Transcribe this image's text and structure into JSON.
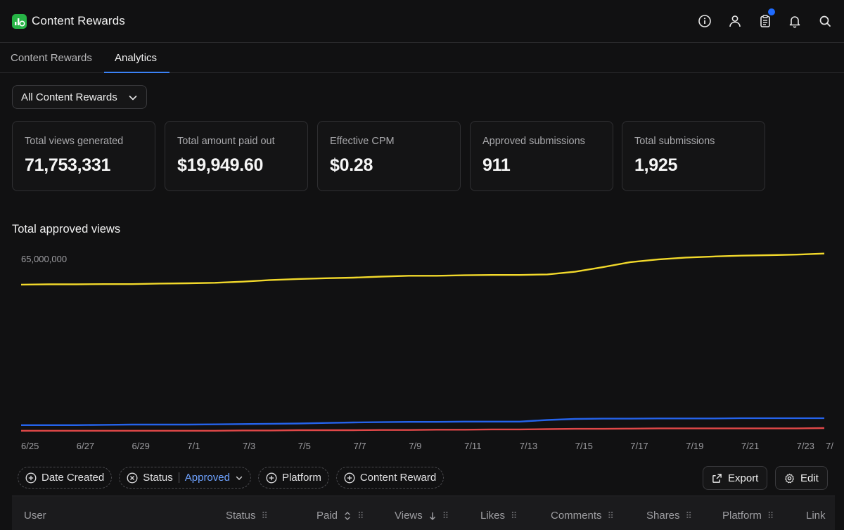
{
  "app": {
    "title": "Content Rewards"
  },
  "header_icons": [
    "info-icon",
    "user-icon",
    "clipboard-icon",
    "bell-icon",
    "search-icon"
  ],
  "tabs": [
    {
      "label": "Content Rewards",
      "active": false
    },
    {
      "label": "Analytics",
      "active": true
    }
  ],
  "filter_dropdown": {
    "label": "All Content Rewards"
  },
  "stats": [
    {
      "label": "Total views generated",
      "value": "71,753,331"
    },
    {
      "label": "Total amount paid out",
      "value": "$19,949.60"
    },
    {
      "label": "Effective CPM",
      "value": "$0.28"
    },
    {
      "label": "Approved submissions",
      "value": "911"
    },
    {
      "label": "Total submissions",
      "value": "1,925"
    }
  ],
  "chart_section": {
    "title": "Total approved views"
  },
  "chart_data": {
    "type": "line",
    "title": "Total approved views",
    "x": [
      "6/25",
      "6/26",
      "6/27",
      "6/28",
      "6/29",
      "6/30",
      "7/1",
      "7/2",
      "7/3",
      "7/4",
      "7/5",
      "7/6",
      "7/7",
      "7/8",
      "7/9",
      "7/10",
      "7/11",
      "7/12",
      "7/13",
      "7/14",
      "7/15",
      "7/16",
      "7/17",
      "7/18",
      "7/19",
      "7/20",
      "7/21",
      "7/22",
      "7/23",
      "7/24"
    ],
    "x_tick_labels": [
      "6/25",
      "6/27",
      "6/29",
      "7/1",
      "7/3",
      "7/5",
      "7/7",
      "7/9",
      "7/11",
      "7/13",
      "7/15",
      "7/17",
      "7/19",
      "7/21",
      "7/23",
      "7/"
    ],
    "y_tick_labels": [
      "65,000,000"
    ],
    "ylim": [
      0,
      70000000
    ],
    "grid": false,
    "series": [
      {
        "color": "#f2d92b",
        "values": [
          55600000,
          55700000,
          55700000,
          55800000,
          55800000,
          56000000,
          56100000,
          56300000,
          56700000,
          57300000,
          57700000,
          58000000,
          58200000,
          58600000,
          58900000,
          58900000,
          59100000,
          59200000,
          59200000,
          59400000,
          60400000,
          62100000,
          64000000,
          65000000,
          65700000,
          66100000,
          66400000,
          66600000,
          66800000,
          67200000
        ]
      },
      {
        "color": "#2563eb",
        "values": [
          3200000,
          3200000,
          3200000,
          3300000,
          3400000,
          3400000,
          3400000,
          3500000,
          3600000,
          3700000,
          3800000,
          4000000,
          4200000,
          4300000,
          4400000,
          4400000,
          4500000,
          4500000,
          4500000,
          5100000,
          5500000,
          5600000,
          5600000,
          5700000,
          5700000,
          5700000,
          5800000,
          5800000,
          5800000,
          5800000
        ]
      },
      {
        "color": "#e04848",
        "values": [
          1100000,
          1100000,
          1100000,
          1100000,
          1100000,
          1100000,
          1100000,
          1100000,
          1200000,
          1200000,
          1300000,
          1300000,
          1300000,
          1400000,
          1400000,
          1500000,
          1500000,
          1600000,
          1600000,
          1700000,
          1800000,
          1800000,
          1900000,
          2000000,
          2000000,
          2000000,
          2000000,
          2000000,
          2000000,
          2100000
        ]
      }
    ]
  },
  "filters": {
    "date_created": "Date Created",
    "status_label": "Status",
    "status_value": "Approved",
    "platform": "Platform",
    "content_reward": "Content Reward"
  },
  "actions": {
    "export": "Export",
    "edit": "Edit"
  },
  "table": {
    "columns": [
      "User",
      "Status",
      "Paid",
      "Views",
      "Likes",
      "Comments",
      "Shares",
      "Platform",
      "Link"
    ]
  }
}
